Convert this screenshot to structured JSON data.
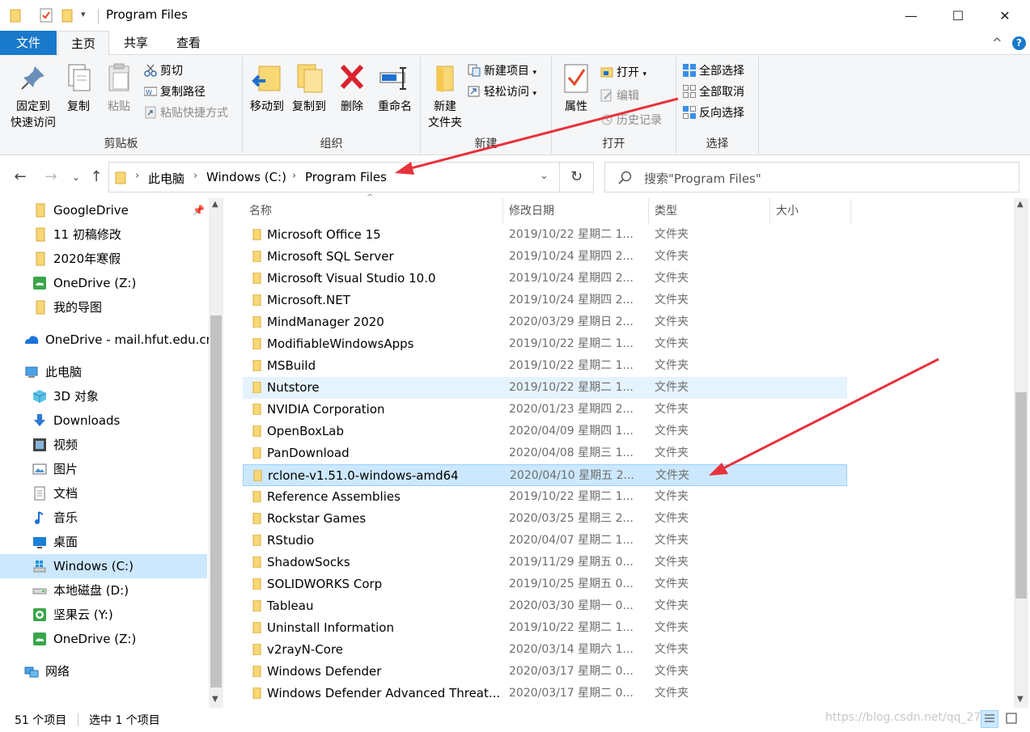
{
  "window": {
    "title": "Program Files",
    "minimize_glyph": "—",
    "maximize_glyph": "☐",
    "close_glyph": "✕"
  },
  "ribbon_tabs": {
    "file": "文件",
    "home": "主页",
    "share": "共享",
    "view": "查看",
    "collapse_glyph": "^",
    "help_glyph": "?"
  },
  "ribbon": {
    "clipboard": {
      "label": "剪贴板",
      "pin_line1": "固定到",
      "pin_line2": "快速访问",
      "copy": "复制",
      "paste": "粘贴",
      "cut": "剪切",
      "copy_path": "复制路径",
      "paste_shortcut": "粘贴快捷方式"
    },
    "organize": {
      "label": "组织",
      "move_to": "移动到",
      "copy_to": "复制到",
      "delete": "删除",
      "rename": "重命名"
    },
    "new": {
      "label": "新建",
      "new_folder_line1": "新建",
      "new_folder_line2": "文件夹",
      "new_item": "新建项目",
      "easy_access": "轻松访问"
    },
    "open": {
      "label": "打开",
      "properties": "属性",
      "open": "打开",
      "edit": "编辑",
      "history": "历史记录"
    },
    "select": {
      "label": "选择",
      "select_all": "全部选择",
      "select_none": "全部取消",
      "invert": "反向选择"
    }
  },
  "address": {
    "crumbs": [
      "此电脑",
      "Windows (C:)",
      "Program Files"
    ],
    "search_placeholder": "搜索\"Program Files\""
  },
  "sidebar": {
    "items": [
      {
        "label": "GoogleDrive",
        "icon": "folder-icon"
      },
      {
        "label": "11 初稿修改",
        "icon": "folder-icon"
      },
      {
        "label": "2020年寒假",
        "icon": "folder-icon"
      },
      {
        "label": "OneDrive (Z:)",
        "icon": "onedrive-drive-icon"
      },
      {
        "label": "我的导图",
        "icon": "folder-icon"
      },
      {
        "label": "OneDrive - mail.hfut.edu.cn",
        "icon": "cloud-icon"
      },
      {
        "label": "此电脑",
        "icon": "computer-icon"
      },
      {
        "label": "3D 对象",
        "icon": "cube-icon"
      },
      {
        "label": "Downloads",
        "icon": "download-icon"
      },
      {
        "label": "视频",
        "icon": "video-icon"
      },
      {
        "label": "图片",
        "icon": "picture-icon"
      },
      {
        "label": "文档",
        "icon": "document-icon"
      },
      {
        "label": "音乐",
        "icon": "music-icon"
      },
      {
        "label": "桌面",
        "icon": "desktop-icon"
      },
      {
        "label": "Windows (C:)",
        "icon": "windows-drive-icon"
      },
      {
        "label": "本地磁盘 (D:)",
        "icon": "disk-icon"
      },
      {
        "label": "坚果云 (Y:)",
        "icon": "nutstore-drive-icon"
      },
      {
        "label": "OneDrive (Z:)",
        "icon": "onedrive-drive-icon"
      },
      {
        "label": "网络",
        "icon": "network-icon"
      }
    ]
  },
  "columns": {
    "name": "名称",
    "modified": "修改日期",
    "type": "类型",
    "size": "大小"
  },
  "files": [
    {
      "name": "Microsoft Office 15",
      "date": "2019/10/22 星期二 1...",
      "type": "文件夹"
    },
    {
      "name": "Microsoft SQL Server",
      "date": "2019/10/24 星期四 2...",
      "type": "文件夹"
    },
    {
      "name": "Microsoft Visual Studio 10.0",
      "date": "2019/10/24 星期四 2...",
      "type": "文件夹"
    },
    {
      "name": "Microsoft.NET",
      "date": "2019/10/24 星期四 2...",
      "type": "文件夹"
    },
    {
      "name": "MindManager 2020",
      "date": "2020/03/29 星期日 2...",
      "type": "文件夹"
    },
    {
      "name": "ModifiableWindowsApps",
      "date": "2019/10/22 星期二 1...",
      "type": "文件夹"
    },
    {
      "name": "MSBuild",
      "date": "2019/10/22 星期二 1...",
      "type": "文件夹"
    },
    {
      "name": "Nutstore",
      "date": "2019/10/22 星期二 1...",
      "type": "文件夹"
    },
    {
      "name": "NVIDIA Corporation",
      "date": "2020/01/23 星期四 2...",
      "type": "文件夹"
    },
    {
      "name": "OpenBoxLab",
      "date": "2020/04/09 星期四 1...",
      "type": "文件夹"
    },
    {
      "name": "PanDownload",
      "date": "2020/04/08 星期三 1...",
      "type": "文件夹"
    },
    {
      "name": "rclone-v1.51.0-windows-amd64",
      "date": "2020/04/10 星期五 2...",
      "type": "文件夹"
    },
    {
      "name": "Reference Assemblies",
      "date": "2019/10/22 星期二 1...",
      "type": "文件夹"
    },
    {
      "name": "Rockstar Games",
      "date": "2020/03/25 星期三 2...",
      "type": "文件夹"
    },
    {
      "name": "RStudio",
      "date": "2020/04/07 星期二 1...",
      "type": "文件夹"
    },
    {
      "name": "ShadowSocks",
      "date": "2019/11/29 星期五 0...",
      "type": "文件夹"
    },
    {
      "name": "SOLIDWORKS Corp",
      "date": "2019/10/25 星期五 0...",
      "type": "文件夹"
    },
    {
      "name": "Tableau",
      "date": "2020/03/30 星期一 0...",
      "type": "文件夹"
    },
    {
      "name": "Uninstall Information",
      "date": "2019/10/22 星期二 1...",
      "type": "文件夹"
    },
    {
      "name": "v2rayN-Core",
      "date": "2020/03/14 星期六 1...",
      "type": "文件夹"
    },
    {
      "name": "Windows Defender",
      "date": "2020/03/17 星期二 0...",
      "type": "文件夹"
    },
    {
      "name": "Windows Defender Advanced Threat...",
      "date": "2020/03/17 星期二 0...",
      "type": "文件夹"
    }
  ],
  "status": {
    "count": "51 个项目",
    "selected": "选中 1 个项目",
    "watermark": "https://blog.csdn.net/qq_270"
  },
  "colors": {
    "accent": "#1979ca",
    "selection": "#cce8ff",
    "hover": "#e5f3ff",
    "folder": "#f8d775",
    "annotation_arrow": "#e8323c"
  }
}
